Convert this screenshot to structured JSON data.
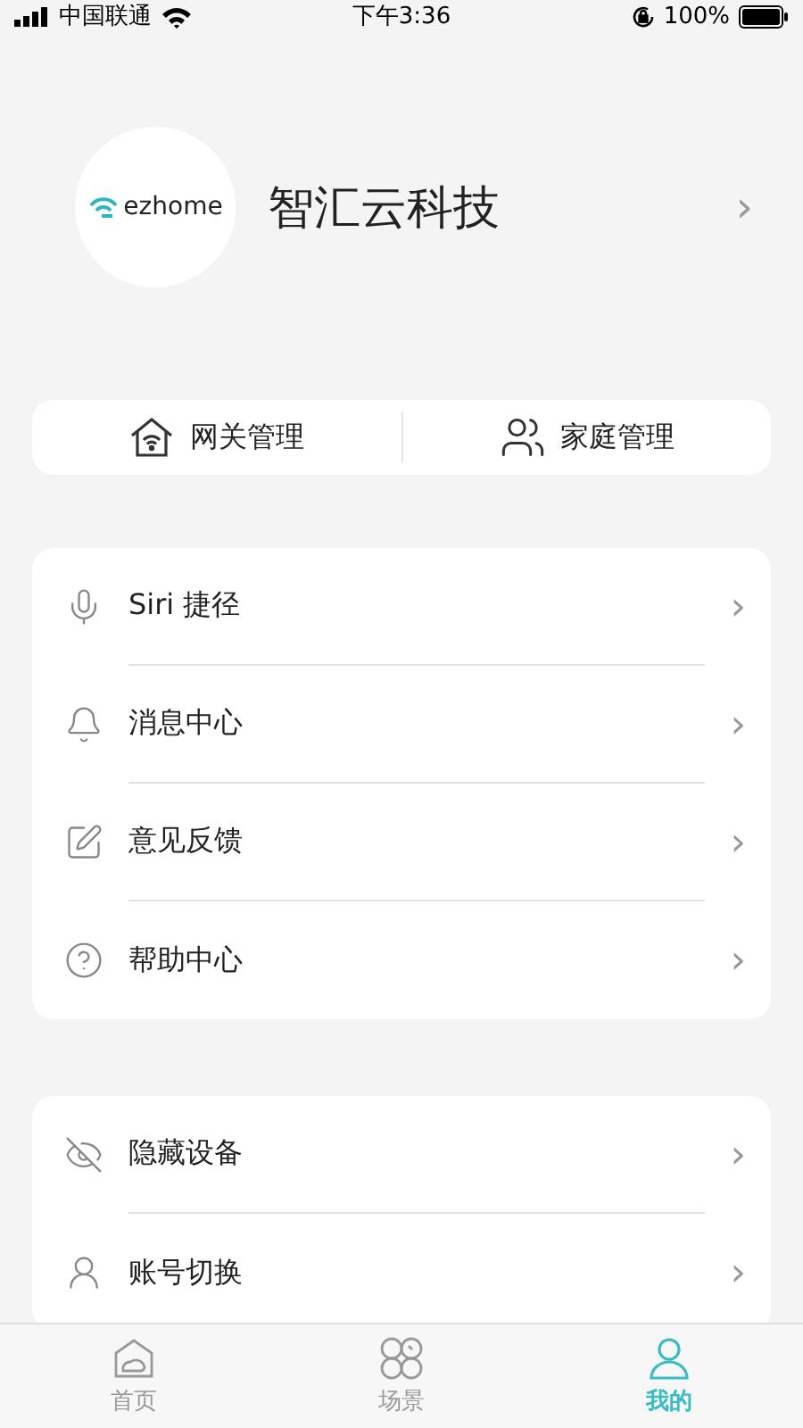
{
  "status_bar": {
    "carrier": "中国联通",
    "time": "下午3:36",
    "battery": "100%"
  },
  "profile": {
    "logo_text": "ezhome",
    "name": "智汇云科技",
    "chevron": "›"
  },
  "quick_actions": [
    {
      "label": "网关管理"
    },
    {
      "label": "家庭管理"
    }
  ],
  "menu_groups": [
    {
      "items": [
        {
          "label": "Siri 捷径",
          "chevron": "›"
        },
        {
          "label": "消息中心",
          "chevron": "›"
        },
        {
          "label": "意见反馈",
          "chevron": "›"
        },
        {
          "label": "帮助中心",
          "chevron": "›"
        }
      ]
    },
    {
      "items": [
        {
          "label": "隐藏设备",
          "chevron": "›"
        },
        {
          "label": "账号切换",
          "chevron": "›"
        }
      ]
    }
  ],
  "tab_bar": [
    {
      "label": "首页",
      "selected": false
    },
    {
      "label": "场景",
      "selected": false
    },
    {
      "label": "我的",
      "selected": true
    }
  ]
}
